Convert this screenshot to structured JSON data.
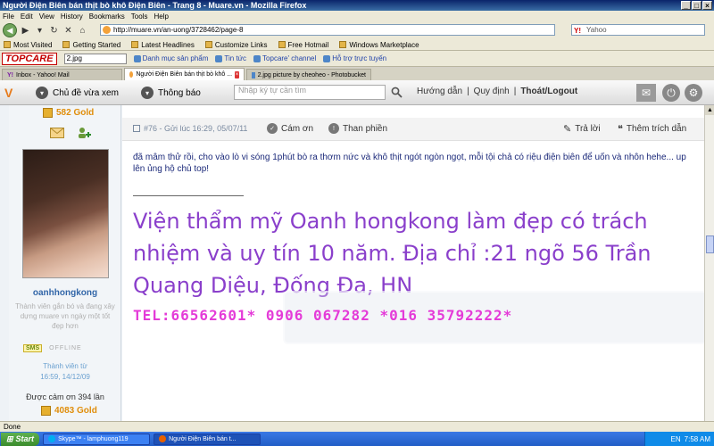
{
  "window": {
    "title": "Người Điện Biên bán thịt bò khô Điện Biên - Trang 8 - Muare.vn - Mozilla Firefox"
  },
  "menu": [
    "File",
    "Edit",
    "View",
    "History",
    "Bookmarks",
    "Tools",
    "Help"
  ],
  "nav": {
    "url": "http://muare.vn/an-uong/3728462/page-8",
    "search_placeholder": "Yahoo"
  },
  "bookmarks": [
    "Most Visited",
    "Getting Started",
    "Latest Headlines",
    "Customize Links",
    "Free Hotmail",
    "Windows Marketplace"
  ],
  "toolbar": {
    "logo": "TOPCARE",
    "input_value": "2.jpg",
    "links": [
      "Danh mục sản phẩm",
      "Tin tức",
      "Topcare' channel",
      "Hỗ trợ trực tuyến"
    ]
  },
  "tabs": [
    {
      "label": "Inbox - Yahoo! Mail",
      "active": false
    },
    {
      "label": "Người Điện Biên bán thịt bò khô ...",
      "active": true
    },
    {
      "label": "2.jpg picture by cheoheo - Photobucket",
      "active": false
    }
  ],
  "forum": {
    "logo": "V",
    "topics_btn": "Chủ đề vừa xem",
    "notify_btn": "Thông báo",
    "search_placeholder": "Nhập ký tự cần tìm",
    "menu": {
      "help": "Hướng dẫn",
      "sep1": "|",
      "rules": "Quy định",
      "sep2": "|",
      "logout": "Thoát/Logout"
    }
  },
  "user": {
    "gold_top": "582 Gold",
    "name": "oanhhongkong",
    "title": "Thành viên gắn bó và đang xây dựng muare vn ngày một tốt đẹp hơn",
    "sms": "SMS",
    "status": "OFFLINE",
    "member_label": "Thành viên từ",
    "member_since": "16:59, 14/12/09",
    "thanks": "Được cảm ơn 394 lần",
    "gold_bottom": "4083 Gold"
  },
  "post": {
    "meta": "#76 - Gửi lúc 16:29, 05/07/11",
    "thank": "Cám ơn",
    "complain": "Than phiền",
    "reply": "Trả lời",
    "quote": "Thêm trích dẫn",
    "body": "đã mâm thử rồi, cho vào lò vi sóng 1phút bò ra thơm nức và khô thịt ngót ngòn ngọt, mỗi tội chả có riệu điện biên để uốn và nhôn hehe... up lên ủng hộ chủ top!",
    "signature": "Viện thẩm mỹ Oanh hongkong làm đẹp có trách nhiệm và uy tín 10 năm. Địa chỉ :21 ngõ 56 Trần Quang Diệu, Đống Đa, HN",
    "phone": "TEL:66562601* 0906 067282 *016 35792222*"
  },
  "statusbar": {
    "text": "Done"
  },
  "taskbar": {
    "start": "Start",
    "items": [
      {
        "label": "Skype™ - lamphuong119",
        "active": false
      },
      {
        "label": "Người Điện Biên bán t...",
        "active": true
      }
    ],
    "lang": "EN",
    "clock": "7:58 AM"
  },
  "colors": {
    "title_bar": "#0a246a",
    "gold": "#e08e0b",
    "username": "#3266a8",
    "signature": "#8a3fcb",
    "phone": "#e43bd8"
  }
}
